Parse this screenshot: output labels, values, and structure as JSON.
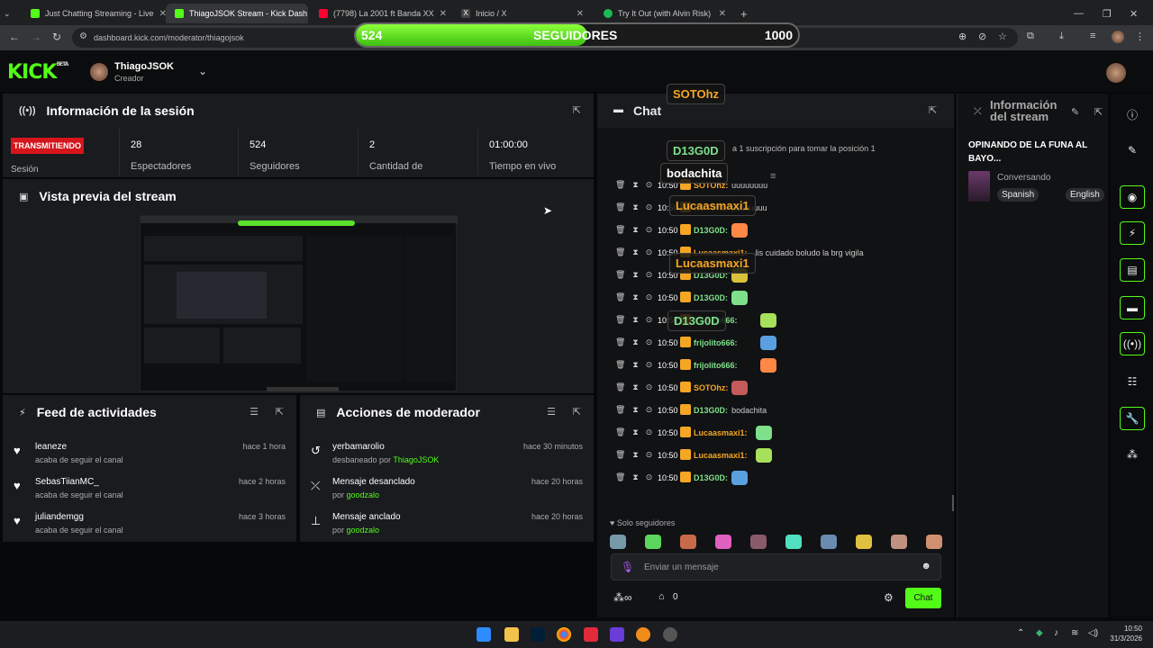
{
  "browser": {
    "tabs": [
      {
        "label": "Just Chatting Streaming - Live",
        "active": false,
        "color": "#53fc18"
      },
      {
        "label": "ThiagoJSOK Stream - Kick Dash",
        "active": true,
        "color": "#53fc18"
      },
      {
        "label": "(7798) La 2001 ft Banda XX",
        "active": false,
        "color": "#ff0033"
      },
      {
        "label": "Inicio / X",
        "active": false,
        "color": "#ffffff"
      },
      {
        "label": "Try It Out (with Alvin Risk)",
        "active": false,
        "color": "#1db954"
      }
    ],
    "url": "dashboard.kick.com/moderator/thiagojsok"
  },
  "follower_goal": {
    "current": "524",
    "label": "SEGUIDORES",
    "target": "1000",
    "progress": 0.524
  },
  "header": {
    "logo": "KICK",
    "logo_sup": "BETA",
    "user": "ThiagoJSOK",
    "role": "Creador"
  },
  "session": {
    "title": "Información de la sesión",
    "status": "TRANSMITIENDO",
    "status_label": "Sesión",
    "stats": [
      {
        "value": "28",
        "label": "Espectadores"
      },
      {
        "value": "524",
        "label": "Seguidores"
      },
      {
        "value": "2",
        "label": "Cantidad de"
      },
      {
        "value": "01:00:00",
        "label": "Tiempo en vivo"
      }
    ]
  },
  "preview": {
    "title": "Vista previa del stream"
  },
  "feed": {
    "title": "Feed de actividades",
    "items": [
      {
        "name": "leaneze",
        "sub": "acaba de seguir el canal",
        "time": "hace 1 hora"
      },
      {
        "name": "SebasTiianMC_",
        "sub": "acaba de seguir el canal",
        "time": "hace 2 horas"
      },
      {
        "name": "juliandemgg",
        "sub": "acaba de seguir el canal",
        "time": "hace 3 horas"
      }
    ]
  },
  "mod_actions": {
    "title": "Acciones de moderador",
    "items": [
      {
        "name": "yerbamarolio",
        "sub": "desbaneado por ",
        "by": "ThiagoJSOK",
        "time": "hace 30 minutos"
      },
      {
        "name": "Mensaje desanclado",
        "sub": "por ",
        "by": "goodzalo",
        "time": "hace 20 horas"
      },
      {
        "name": "Mensaje anclado",
        "sub": "por ",
        "by": "goodzalo",
        "time": "hace 20 horas"
      }
    ]
  },
  "chat": {
    "title": "Chat",
    "sub_notice": "a 1 suscripción para tomar la posición 1",
    "lines": [
      {
        "time": "10:50",
        "user": "SOTOhz:",
        "msg": "uuuuuuuu",
        "color": "#f5a623"
      },
      {
        "time": "10:50",
        "user": "SOTOhz:",
        "msg": "pachuuuu",
        "color": "#f5a623"
      },
      {
        "time": "10:50",
        "user": "D13G0D:",
        "msg": "",
        "color": "#7ee08a"
      },
      {
        "time": "10:50",
        "user": "Lucaasmaxi1:",
        "msg": "lis cuidado boludo la brg vigila",
        "color": "#f5a623"
      },
      {
        "time": "10:50",
        "user": "D13G0D:",
        "msg": "",
        "color": "#7ee08a"
      },
      {
        "time": "10:50",
        "user": "D13G0D:",
        "msg": "",
        "color": "#7ee08a"
      },
      {
        "time": "10:50",
        "user": "frijolito666:",
        "msg": "",
        "color": "#7ee08a"
      },
      {
        "time": "10:50",
        "user": "frijolito666:",
        "msg": "",
        "color": "#7ee08a"
      },
      {
        "time": "10:50",
        "user": "frijolito666:",
        "msg": "",
        "color": "#7ee08a"
      },
      {
        "time": "10:50",
        "user": "SOTOhz:",
        "msg": "",
        "color": "#f5a623"
      },
      {
        "time": "10:50",
        "user": "D13G0D:",
        "msg": "bodachita",
        "color": "#7ee08a"
      },
      {
        "time": "10:50",
        "user": "Lucaasmaxi1:",
        "msg": "",
        "color": "#f5a623"
      },
      {
        "time": "10:50",
        "user": "Lucaasmaxi1:",
        "msg": "",
        "color": "#f5a623"
      },
      {
        "time": "10:50",
        "user": "D13G0D:",
        "msg": "",
        "color": "#7ee08a"
      }
    ],
    "overlays": [
      {
        "text": "SOTOhz",
        "color": "#f5a623"
      },
      {
        "text": "D13G0D",
        "color": "#7ee08a"
      },
      {
        "text": "bodachita",
        "color": "#ffffff"
      },
      {
        "text": "Lucaasmaxi1",
        "color": "#f5a623"
      },
      {
        "text": "Lucaasmaxi1",
        "color": "#f5a623"
      },
      {
        "text": "D13G0D",
        "color": "#7ee08a"
      }
    ],
    "followers_only": "Solo seguidores",
    "input_placeholder": "Enviar un mensaje",
    "count": "0",
    "send_label": "Chat"
  },
  "stream_info": {
    "title": "Información del stream",
    "stream_title": "OPINANDO DE LA FUNA AL BAYO...",
    "category": "Conversando",
    "tags": [
      "Spanish",
      "English"
    ]
  },
  "taskbar": {
    "time": "10:50",
    "date": "31/3/2026"
  }
}
